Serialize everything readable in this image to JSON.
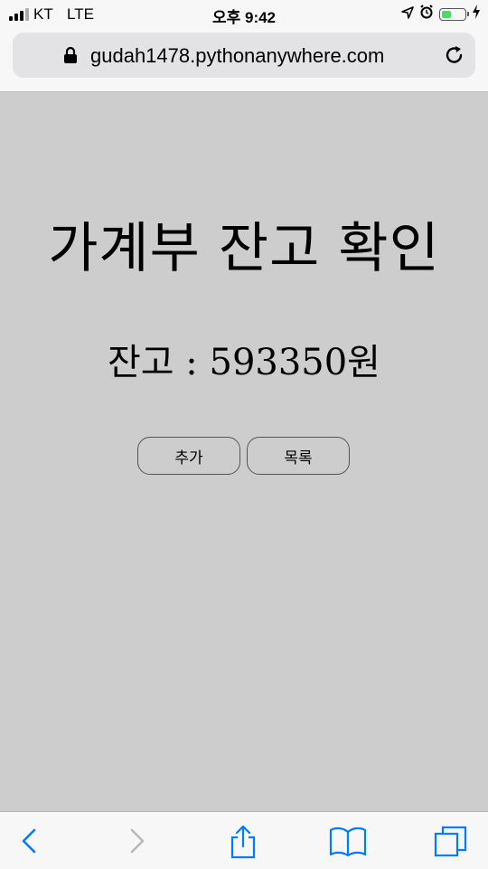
{
  "status_bar": {
    "carrier": "KT",
    "network": "LTE",
    "time": "오후 9:42",
    "battery_level": 0.45,
    "icons": [
      "signal-icon",
      "location-icon",
      "alarm-icon",
      "battery-icon",
      "charging-icon"
    ]
  },
  "browser": {
    "url": "gudah1478.pythonanywhere.com",
    "icons": [
      "lock-icon",
      "reload-icon"
    ]
  },
  "page": {
    "title": "가계부 잔고 확인",
    "balance_text": "잔고 : 593350원",
    "buttons": {
      "add_label": "추가",
      "list_label": "목록"
    }
  },
  "toolbar": {
    "icons": [
      "back-icon",
      "forward-icon",
      "share-icon",
      "bookmarks-icon",
      "tabs-icon"
    ]
  },
  "colors": {
    "page_background": "#cdcdcd",
    "chrome_background": "#f7f7f7",
    "accent": "#007aff",
    "battery": "#4cd964"
  }
}
